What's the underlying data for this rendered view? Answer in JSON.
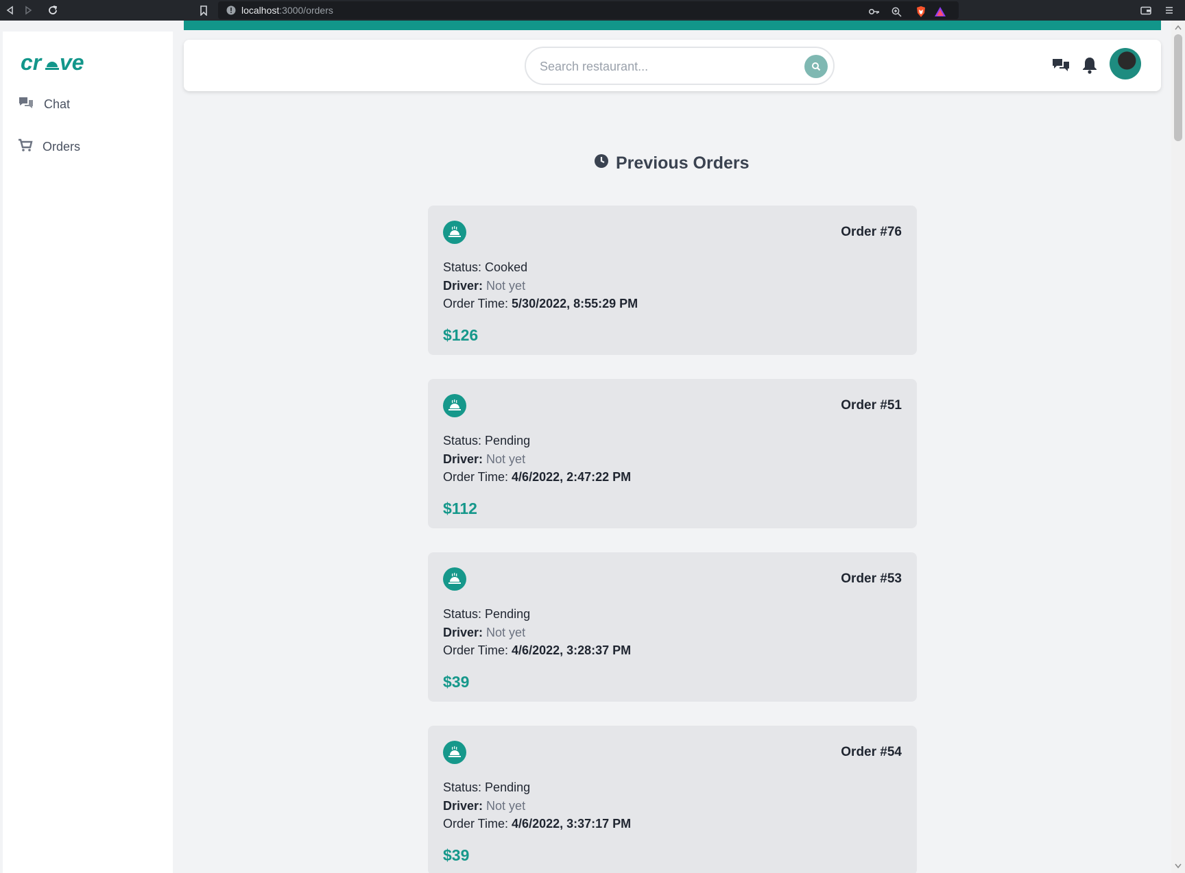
{
  "browser": {
    "url_host": "localhost",
    "url_path": ":3000/orders"
  },
  "sidebar": {
    "logo_text": "crave",
    "items": [
      {
        "label": "Chat",
        "icon": "chat-bubbles-icon"
      },
      {
        "label": "Orders",
        "icon": "cart-icon"
      }
    ]
  },
  "header": {
    "search_placeholder": "Search restaurant..."
  },
  "main": {
    "title": "Previous Orders",
    "orders": [
      {
        "number": "Order #76",
        "status_label": "Status:",
        "status": "Cooked",
        "driver_label": "Driver:",
        "driver": "Not yet",
        "time_label": "Order Time:",
        "time": "5/30/2022, 8:55:29 PM",
        "price": "$126"
      },
      {
        "number": "Order #51",
        "status_label": "Status:",
        "status": "Pending",
        "driver_label": "Driver:",
        "driver": "Not yet",
        "time_label": "Order Time:",
        "time": "4/6/2022, 2:47:22 PM",
        "price": "$112"
      },
      {
        "number": "Order #53",
        "status_label": "Status:",
        "status": "Pending",
        "driver_label": "Driver:",
        "driver": "Not yet",
        "time_label": "Order Time:",
        "time": "4/6/2022, 3:28:37 PM",
        "price": "$39"
      },
      {
        "number": "Order #54",
        "status_label": "Status:",
        "status": "Pending",
        "driver_label": "Driver:",
        "driver": "Not yet",
        "time_label": "Order Time:",
        "time": "4/6/2022, 3:37:17 PM",
        "price": "$39"
      }
    ]
  },
  "colors": {
    "accent": "#16988b",
    "browser_bg": "#24272c"
  }
}
